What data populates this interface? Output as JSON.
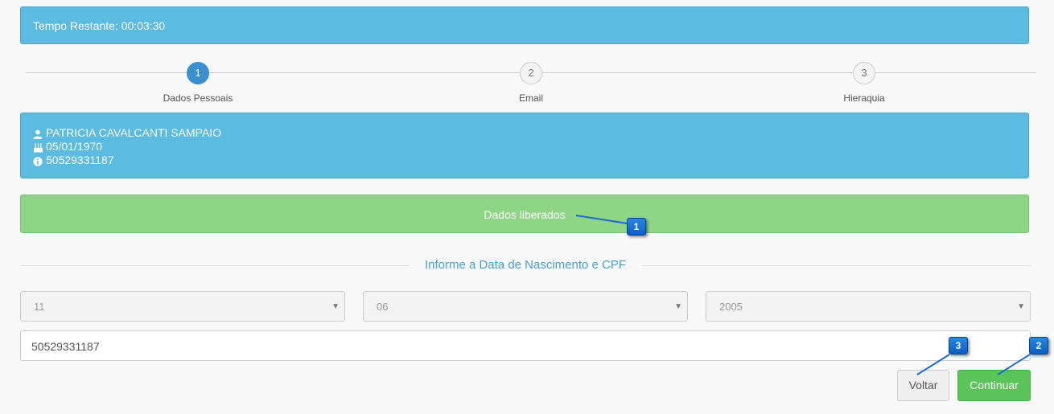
{
  "timer": {
    "text": "Tempo Restante: 00:03:30"
  },
  "steps": [
    {
      "number": "1",
      "label": "Dados Pessoais",
      "active": true
    },
    {
      "number": "2",
      "label": "Email",
      "active": false
    },
    {
      "number": "3",
      "label": "Hieraquia",
      "active": false
    }
  ],
  "person": {
    "name": "PATRICIA CAVALCANTI SAMPAIO",
    "birthdate": "05/01/1970",
    "cpf": "50529331187",
    "icons": [
      "user-icon",
      "birthday-cake-icon",
      "info-circle-icon"
    ]
  },
  "status": {
    "text": "Dados liberados"
  },
  "form": {
    "section_title": "Informe a Data de Nascimento e CPF",
    "day": "11",
    "month": "06",
    "year": "2005",
    "cpf_value": "50529331187"
  },
  "buttons": {
    "back": "Voltar",
    "continue": "Continuar"
  },
  "callouts": [
    "1",
    "2",
    "3"
  ],
  "colors": {
    "info": "#5bbbe0",
    "success": "#8ed585",
    "primary_step": "#3a8fd0",
    "continue_button": "#5cc35a",
    "callout": "#1a73d6"
  }
}
